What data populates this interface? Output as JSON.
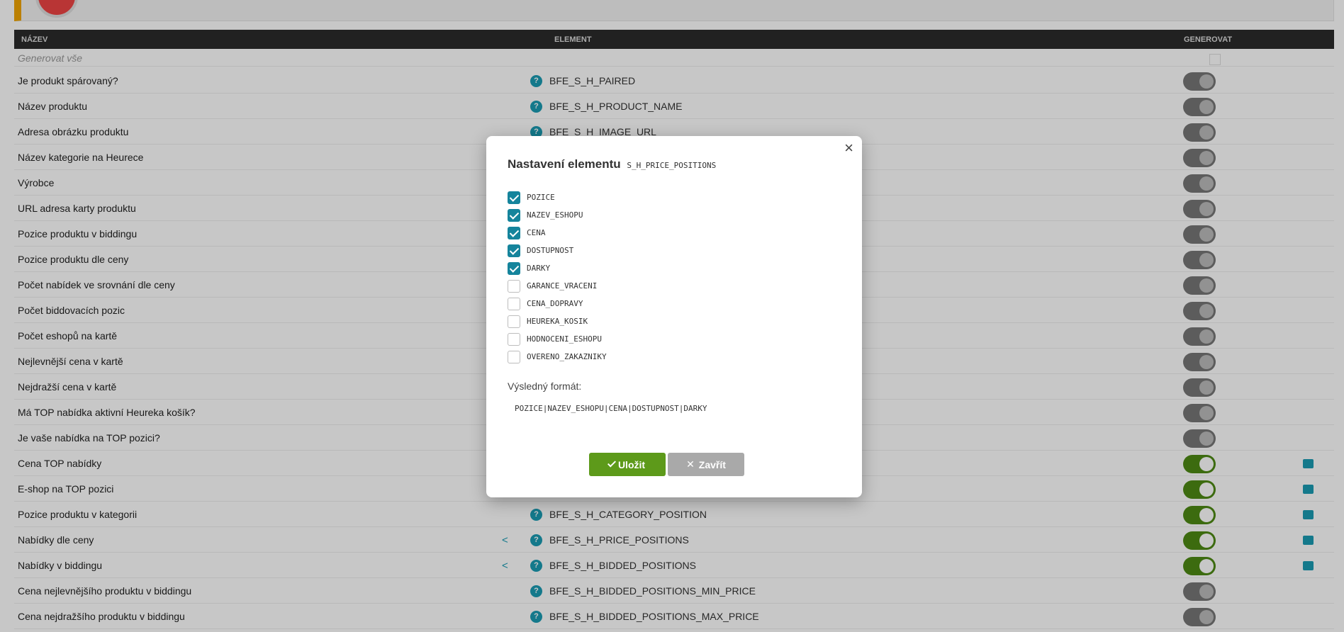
{
  "header": {
    "col_name": "NÁZEV",
    "col_element": "ELEMENT",
    "col_generate": "GENEROVAT"
  },
  "generate_all_label": "Generovat vše",
  "rows": [
    {
      "name": "Je produkt spárovaný?",
      "element": "BFE_S_H_PAIRED",
      "on": false
    },
    {
      "name": "Název produktu",
      "element": "BFE_S_H_PRODUCT_NAME",
      "on": false
    },
    {
      "name": "Adresa obrázku produktu",
      "element": "BFE_S_H_IMAGE_URL",
      "on": false
    },
    {
      "name": "Název kategorie na Heurece",
      "element": "",
      "on": false
    },
    {
      "name": "Výrobce",
      "element": "",
      "on": false
    },
    {
      "name": "URL adresa karty produktu",
      "element": "",
      "on": false
    },
    {
      "name": "Pozice produktu v biddingu",
      "element": "",
      "on": false
    },
    {
      "name": "Pozice produktu dle ceny",
      "element": "",
      "on": false
    },
    {
      "name": "Počet nabídek ve srovnání dle ceny",
      "element": "",
      "on": false
    },
    {
      "name": "Počet biddovacích pozic",
      "element": "",
      "on": false
    },
    {
      "name": "Počet eshopů na kartě",
      "element": "",
      "on": false
    },
    {
      "name": "Nejlevnější cena v kartě",
      "element": "",
      "on": false
    },
    {
      "name": "Nejdražší cena v kartě",
      "element": "",
      "on": false
    },
    {
      "name": "Má TOP nabídka aktivní Heureka košík?",
      "element": "",
      "on": false
    },
    {
      "name": "Je vaše nabídka na TOP pozici?",
      "element": "",
      "on": false
    },
    {
      "name": "Cena TOP nabídky",
      "element": "",
      "on": true
    },
    {
      "name": "E-shop na TOP pozici",
      "element": "",
      "on": true
    },
    {
      "name": "Pozice produktu v kategorii",
      "element": "BFE_S_H_CATEGORY_POSITION",
      "on": true
    },
    {
      "name": "Nabídky dle ceny",
      "element": "BFE_S_H_PRICE_POSITIONS",
      "on": true,
      "share": true
    },
    {
      "name": "Nabídky v biddingu",
      "element": "BFE_S_H_BIDDED_POSITIONS",
      "on": true,
      "share": true
    },
    {
      "name": "Cena nejlevnějšího produktu v biddingu",
      "element": "BFE_S_H_BIDDED_POSITIONS_MIN_PRICE",
      "on": false
    },
    {
      "name": "Cena nejdražšího produktu v biddingu",
      "element": "BFE_S_H_BIDDED_POSITIONS_MAX_PRICE",
      "on": false
    }
  ],
  "modal": {
    "title": "Nastavení elementu",
    "element_code": "S_H_PRICE_POSITIONS",
    "close_glyph": "×",
    "options": [
      {
        "label": "POZICE",
        "checked": true
      },
      {
        "label": "NAZEV_ESHOPU",
        "checked": true
      },
      {
        "label": "CENA",
        "checked": true
      },
      {
        "label": "DOSTUPNOST",
        "checked": true
      },
      {
        "label": "DARKY",
        "checked": true
      },
      {
        "label": "GARANCE_VRACENI",
        "checked": false
      },
      {
        "label": "CENA_DOPRAVY",
        "checked": false
      },
      {
        "label": "HEUREKA_KOSIK",
        "checked": false
      },
      {
        "label": "HODNOCENI_ESHOPU",
        "checked": false
      },
      {
        "label": "OVERENO_ZAKAZNIKY",
        "checked": false
      }
    ],
    "result_label": "Výsledný formát:",
    "result_value": "POZICE|NAZEV_ESHOPU|CENA|DOSTUPNOST|DARKY",
    "save_label": "Uložit",
    "close_label": "Zavřít"
  },
  "colors": {
    "accent": "#15849c",
    "save": "#5d9a1a",
    "toggle_on": "#4e8a14",
    "header_bg": "#2b2b2b"
  }
}
